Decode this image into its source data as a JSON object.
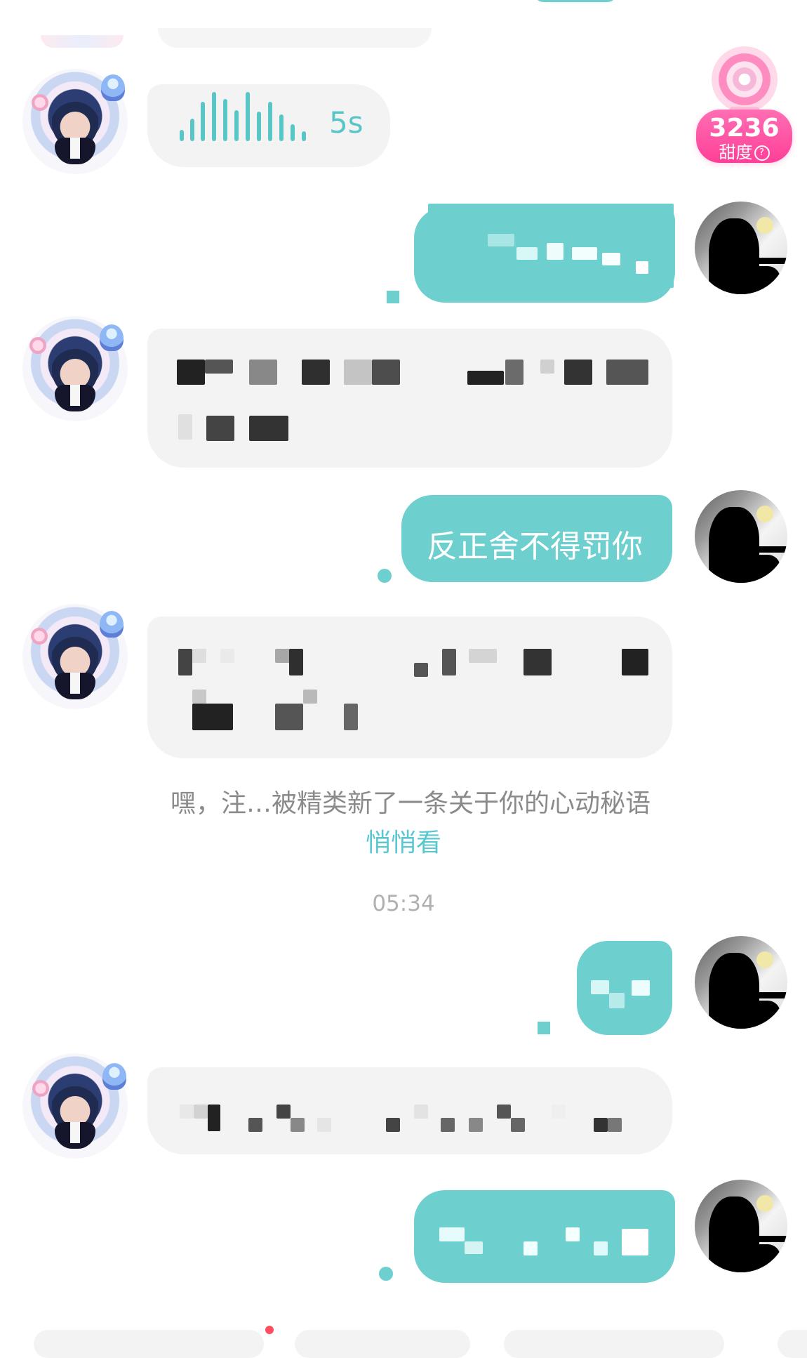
{
  "chat": {
    "voice_message": {
      "duration": "5s"
    },
    "messages": [
      {
        "sender": "user",
        "text": "反正舍不得罚你"
      }
    ],
    "notice": {
      "text": "嘿，注…被精类新了一条关于你的心动秘语",
      "action": "悄悄看"
    },
    "timestamp": "05:34"
  },
  "badge": {
    "value": "3236",
    "label": "甜度"
  },
  "colors": {
    "accent": "#6ECFCF",
    "accent_text": "#59C7CF",
    "badge_pink": "#FF4E9E"
  },
  "icons": {
    "badge_info": "question-circle-icon"
  }
}
